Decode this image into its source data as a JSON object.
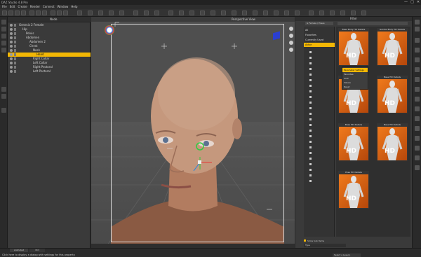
{
  "window": {
    "title": "DAZ Studio 4.8 Pro",
    "minimize": "—",
    "maximize": "□",
    "close": "✕"
  },
  "menu": [
    "File",
    "Edit",
    "Create",
    "Render",
    "Connect",
    "Window",
    "Help"
  ],
  "scene": {
    "header": "Node",
    "items": [
      {
        "label": "Genesis 2 Female",
        "indent": 0,
        "selected": false
      },
      {
        "label": "Hip",
        "indent": 1,
        "selected": false
      },
      {
        "label": "Pelvis",
        "indent": 2,
        "selected": false
      },
      {
        "label": "Abdomen",
        "indent": 2,
        "selected": false
      },
      {
        "label": "Abdomen 2",
        "indent": 3,
        "selected": false
      },
      {
        "label": "Chest",
        "indent": 3,
        "selected": false
      },
      {
        "label": "Neck",
        "indent": 4,
        "selected": false
      },
      {
        "label": "Head",
        "indent": 5,
        "selected": true
      },
      {
        "label": "Right Collar",
        "indent": 4,
        "selected": false
      },
      {
        "label": "Left Collar",
        "indent": 4,
        "selected": false
      },
      {
        "label": "Right Pectoral",
        "indent": 4,
        "selected": false
      },
      {
        "label": "Left Pectoral",
        "indent": 4,
        "selected": false
      }
    ]
  },
  "viewport": {
    "camera": "Perspective View"
  },
  "content": {
    "header": "Filter",
    "dropdown": "G Female / Poses",
    "search_placeholder": "Filter",
    "categories": [
      {
        "label": "All",
        "selected": false
      },
      {
        "label": "Favorites",
        "selected": false
      },
      {
        "label": "Currently Used",
        "selected": false
      },
      {
        "label": "Actor",
        "selected": true
      }
    ],
    "thumbs": [
      {
        "caption": "Base Body HD Details",
        "badge": "HD"
      },
      {
        "caption": "Genital Body HD Details",
        "badge": "HD"
      },
      {
        "caption": "Base HD Details",
        "badge": "HD"
      },
      {
        "caption": "Base HD Details",
        "badge": "HD"
      },
      {
        "caption": "Base HD Details",
        "badge": "HD"
      },
      {
        "caption": "Base HD Details",
        "badge": "HD"
      },
      {
        "caption": "Pose HD Details",
        "badge": "HD"
      }
    ],
    "context_menu": [
      {
        "label": "Parameter Settings",
        "selected": true
      },
      {
        "label": "Favorites",
        "selected": false
      },
      {
        "label": "Lock",
        "selected": false
      },
      {
        "label": "Values",
        "selected": false
      },
      {
        "label": "Reset",
        "selected": false
      }
    ],
    "show_sub_items": "Show Sub Items",
    "search_box": "Type"
  },
  "status": {
    "tabs": [
      "animated",
      "Ctrl"
    ],
    "hint": "Click here to display a dialog with settings for this property.",
    "lesson": "Select a Lesson"
  },
  "colors": {
    "accent": "#f2b705",
    "thumb_bg": "#f07a1c"
  }
}
